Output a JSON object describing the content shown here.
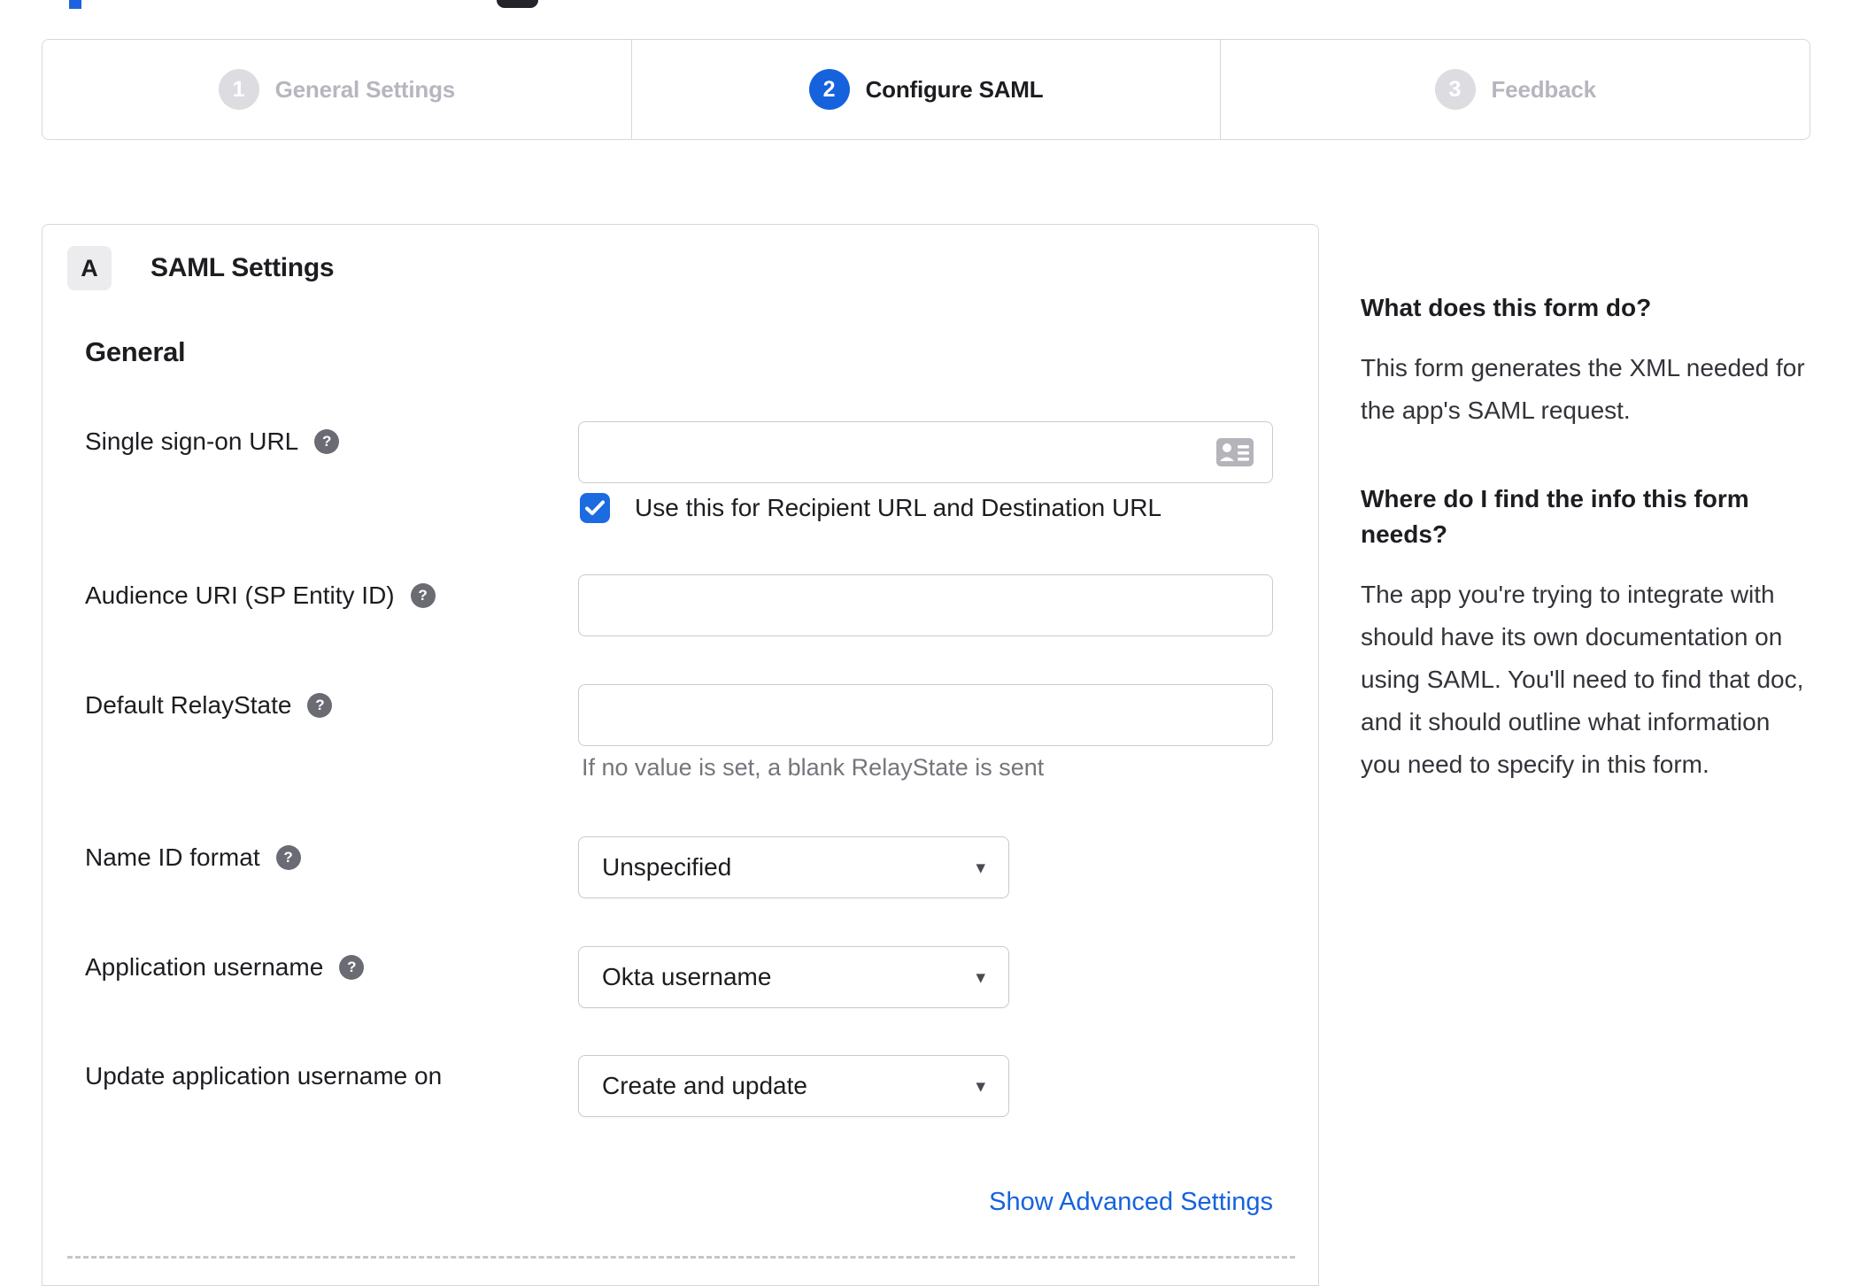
{
  "stepper": {
    "steps": [
      {
        "number": "1",
        "label": "General Settings",
        "state": "inactive"
      },
      {
        "number": "2",
        "label": "Configure SAML",
        "state": "active"
      },
      {
        "number": "3",
        "label": "Feedback",
        "state": "inactive"
      }
    ]
  },
  "panel": {
    "badge": "A",
    "title": "SAML Settings",
    "section": "General",
    "fields": {
      "sso": {
        "label": "Single sign-on URL",
        "value": "",
        "checkbox_label": "Use this for Recipient URL and Destination URL",
        "checkbox_checked": true
      },
      "audience": {
        "label": "Audience URI (SP Entity ID)",
        "value": ""
      },
      "relay": {
        "label": "Default RelayState",
        "value": "",
        "hint": "If no value is set, a blank RelayState is sent"
      },
      "name_id": {
        "label": "Name ID format",
        "value": "Unspecified"
      },
      "app_username": {
        "label": "Application username",
        "value": "Okta username"
      },
      "update_username": {
        "label": "Update application username on",
        "value": "Create and update"
      }
    },
    "advanced_link": "Show Advanced Settings"
  },
  "sidebar": {
    "q1_title": "What does this form do?",
    "q1_body": "This form generates the XML needed for the app's SAML request.",
    "q2_title": "Where do I find the info this form needs?",
    "q2_body": "The app you're trying to integrate with should have its own documentation on using SAML. You'll need to find that doc, and it should outline what information you need to specify in this form."
  },
  "icons": {
    "help_glyph": "?",
    "dropdown_arrow": "▾"
  },
  "colors": {
    "accent": "#1662dd",
    "checkbox": "#1c6be1",
    "link": "#1662dd",
    "border": "#d8d8dc"
  }
}
